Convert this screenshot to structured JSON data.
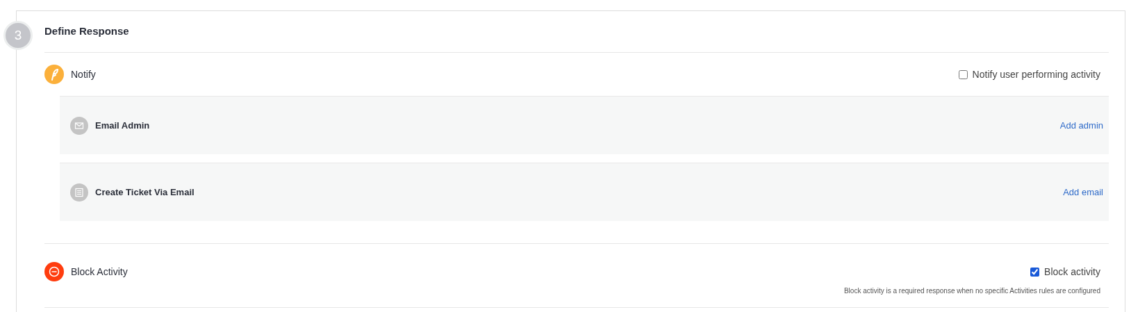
{
  "step": {
    "number": "3",
    "title": "Define Response"
  },
  "notify": {
    "label": "Notify",
    "option": {
      "label": "Notify user performing activity",
      "checked": false
    },
    "actions": [
      {
        "kind": "mail",
        "title": "Email Admin",
        "link": "Add admin"
      },
      {
        "kind": "ticket",
        "title": "Create Ticket Via Email",
        "link": "Add email"
      }
    ]
  },
  "block": {
    "label": "Block Activity",
    "option": {
      "label": "Block activity",
      "checked": true
    },
    "note": "Block activity is a required response when no specific Activities rules are configured"
  }
}
